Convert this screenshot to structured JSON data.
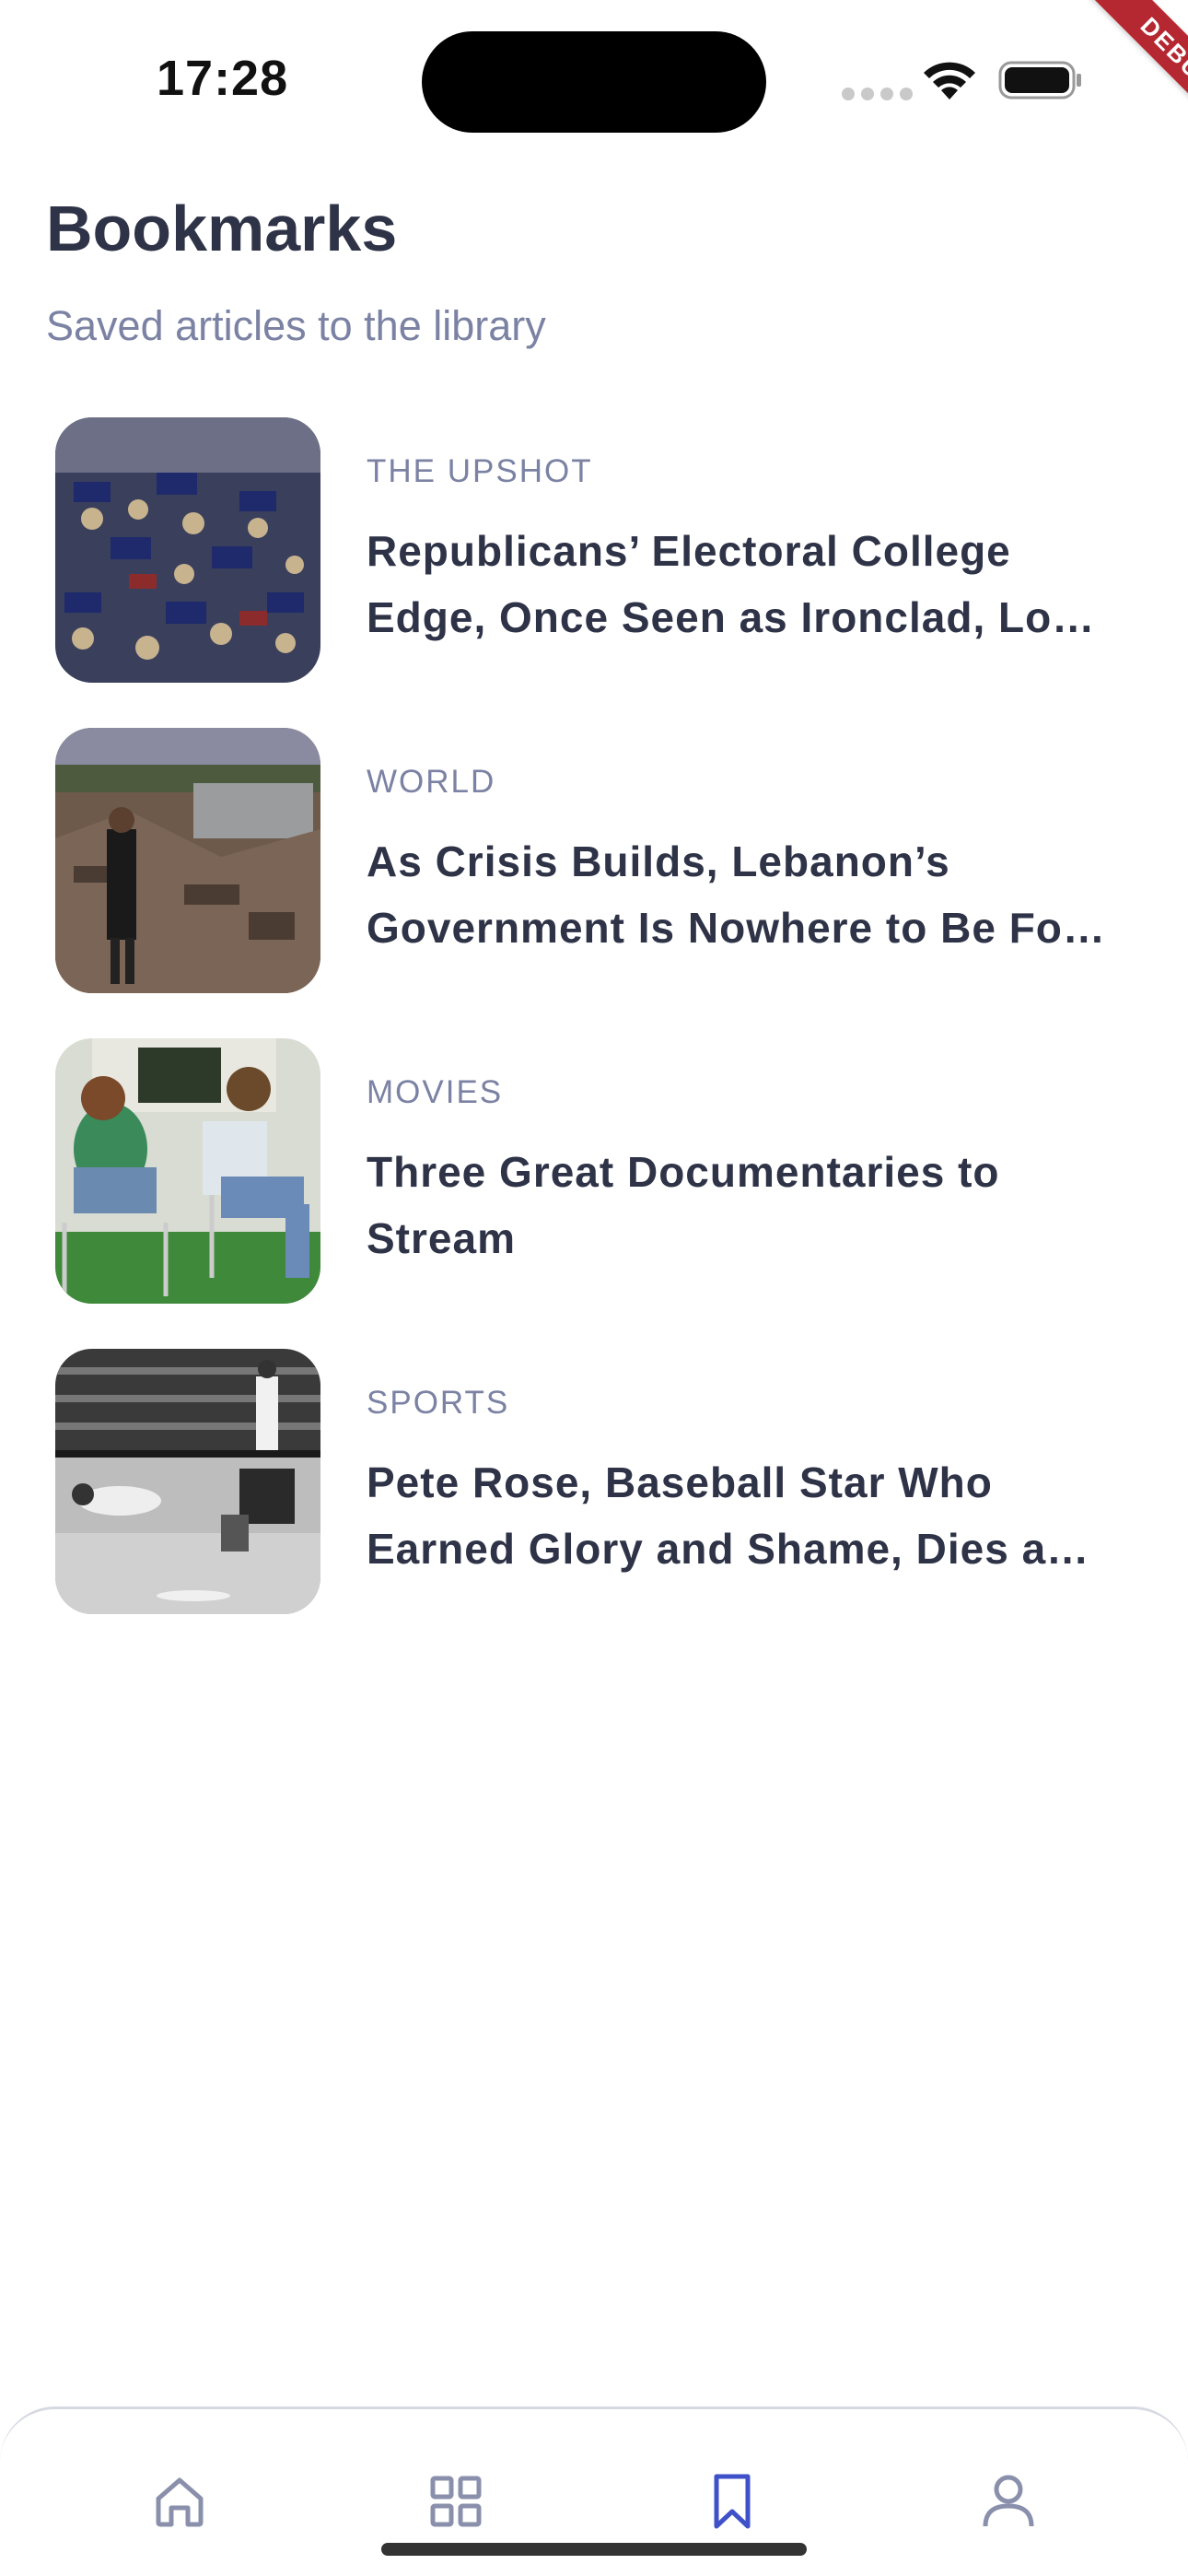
{
  "status_bar": {
    "time": "17:28",
    "debug_label": "DEBUG"
  },
  "header": {
    "title": "Bookmarks",
    "subtitle": "Saved articles to the library"
  },
  "bookmarks": [
    {
      "section": "THE UPSHOT",
      "title": "Republicans’ Electoral College Edge, Once Seen as Ironclad, Lo…",
      "image": "crowd-rally-photo"
    },
    {
      "section": "WORLD",
      "title": "As Crisis Builds, Lebanon’s Government Is Nowhere to Be Fo…",
      "image": "rubble-photo"
    },
    {
      "section": "MOVIES",
      "title": "Three Great Documentaries to Stream",
      "image": "lawn-chairs-photo"
    },
    {
      "section": "SPORTS",
      "title": "Pete Rose, Baseball Star Who Earned Glory and Shame, Dies a…",
      "image": "baseball-slide-photo"
    }
  ],
  "bottom_nav": {
    "items": [
      "home",
      "categories",
      "bookmarks",
      "profile"
    ],
    "active": "bookmarks",
    "colors": {
      "active": "#3f51c8",
      "inactive": "#8a90ab"
    }
  }
}
